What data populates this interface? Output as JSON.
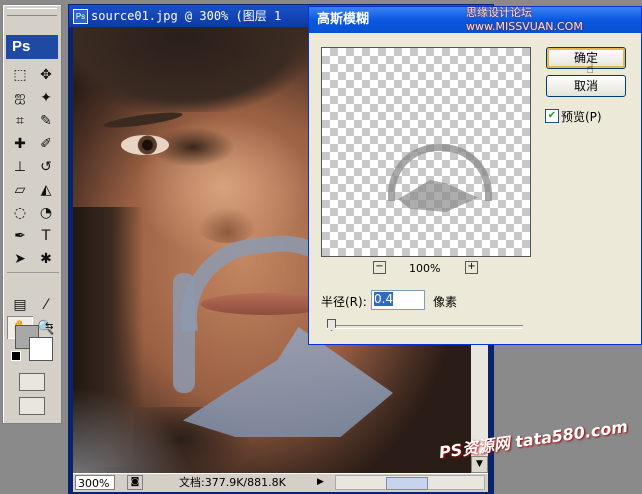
{
  "app": {
    "logo": "Ps"
  },
  "tools": [
    {
      "name": "rect-marquee-icon",
      "glyph": "⬚"
    },
    {
      "name": "move-icon",
      "glyph": "✥"
    },
    {
      "name": "lasso-icon",
      "glyph": "ஐ"
    },
    {
      "name": "magic-wand-icon",
      "glyph": "✦"
    },
    {
      "name": "crop-icon",
      "glyph": "⌗"
    },
    {
      "name": "slice-icon",
      "glyph": "✎"
    },
    {
      "name": "healing-brush-icon",
      "glyph": "✚"
    },
    {
      "name": "brush-icon",
      "glyph": "✐"
    },
    {
      "name": "clone-stamp-icon",
      "glyph": "⊥"
    },
    {
      "name": "history-brush-icon",
      "glyph": "↺"
    },
    {
      "name": "eraser-icon",
      "glyph": "▱"
    },
    {
      "name": "paint-bucket-icon",
      "glyph": "◭"
    },
    {
      "name": "blur-icon",
      "glyph": "◌"
    },
    {
      "name": "dodge-icon",
      "glyph": "◔"
    },
    {
      "name": "pen-icon",
      "glyph": "✒"
    },
    {
      "name": "type-icon",
      "glyph": "T"
    },
    {
      "name": "path-select-icon",
      "glyph": "➤"
    },
    {
      "name": "custom-shape-icon",
      "glyph": "✱"
    },
    {
      "name": "notes-icon",
      "glyph": "▤"
    },
    {
      "name": "eyedropper-icon",
      "glyph": "⁄"
    },
    {
      "name": "hand-icon",
      "glyph": "✋",
      "active": true
    },
    {
      "name": "zoom-icon",
      "glyph": "🔍"
    }
  ],
  "document": {
    "title": "source01.jpg @ 300% (图层 1",
    "ps_icon": "Ps",
    "zoom": "300%",
    "size": "文档:377.9K/881.8K"
  },
  "dialog": {
    "title": "高斯模糊",
    "ok": "确定",
    "cancel": "取消",
    "preview_label": "预览(P)",
    "preview_checked": true,
    "preview_zoom": "100%",
    "radius_label": "半径(R):",
    "radius_value": "0.4",
    "radius_unit": "像素"
  },
  "watermarks": {
    "top": "思缘设计论坛 www.MISSVUAN.COM",
    "bottom": "PS资源网 tata580.com"
  }
}
